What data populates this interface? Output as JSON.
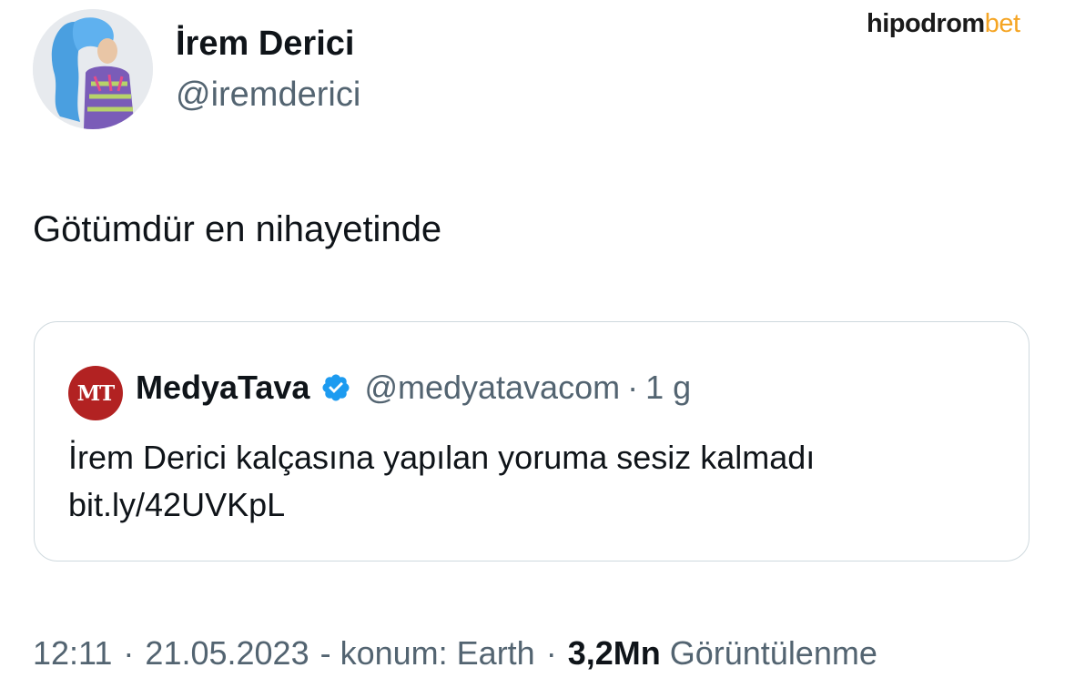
{
  "tweet": {
    "author": {
      "display_name": "İrem Derici",
      "handle": "@iremderici"
    },
    "text": "Götümdür en nihayetinde",
    "quote": {
      "logo_text": "MT",
      "name": "MedyaTava",
      "handle": "@medyatavacom",
      "separator": "·",
      "time": "1 g",
      "text_line1": "İrem Derici kalçasına yapılan yoruma sesiz kalmadı",
      "text_line2": "bit.ly/42UVKpL"
    },
    "meta": {
      "time": "12:11",
      "date": "21.05.2023",
      "location": "- konum: Earth",
      "separator": "·",
      "views_count": "3,2Mn",
      "views_label": "Görüntülenme"
    }
  },
  "watermark": {
    "part1": "hipodrom",
    "part2": "bet"
  },
  "colors": {
    "text_primary": "#0f1419",
    "text_secondary": "#536471",
    "card_border": "#cfd9de",
    "verified_blue": "#1d9bf0",
    "quote_logo_red": "#b22222",
    "watermark_orange": "#f5a524"
  },
  "icons": {
    "avatar": "profile-photo",
    "verified": "verified-badge-icon"
  }
}
